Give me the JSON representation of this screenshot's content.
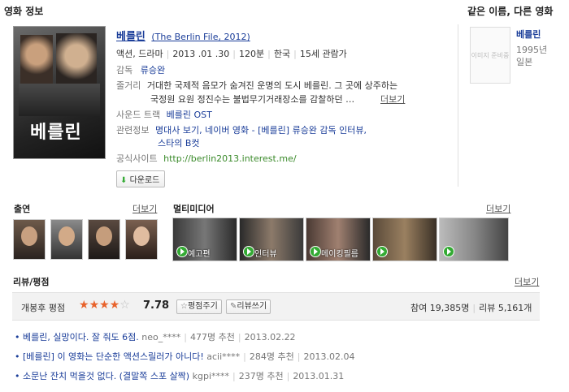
{
  "section_title": "영화 정보",
  "related_title": "같은 이름, 다른 영화",
  "movie": {
    "title": "베를린",
    "title_en": "(The Berlin File, 2012)",
    "genre": "액션, 드라마",
    "release": "2013 .01 .30",
    "runtime": "120분",
    "country": "한국",
    "rating": "15세 관람가",
    "director_label": "감독",
    "director": "류승완",
    "plot_label": "줄거리",
    "plot_line1": "거대한 국제적 음모가 숨겨진 운명의 도시 베를린. 그 곳에 상주하는",
    "plot_line2": "국정원 요원 정진수는 불법무기거래장소를 감찰하던 …",
    "plot_more": "더보기",
    "ost_label": "사운드 트랙",
    "ost": "베를린 OST",
    "info_label": "관련정보",
    "info_line1": "명대사 보기, 네이버 영화 - [베를린] 류승완 감독 인터뷰,",
    "info_line2": "스타의 B컷",
    "site_label": "공식사이트",
    "site": "http://berlin2013.interest.me/",
    "download": "다운로드"
  },
  "related": {
    "placeholder": "이미지 준비중",
    "title": "베를린",
    "year": "1995년",
    "country": "일본"
  },
  "cast": {
    "title": "출연",
    "more": "더보기"
  },
  "multimedia": {
    "title": "멀티미디어",
    "more": "더보기",
    "items": [
      "예고편",
      "인터뷰",
      "메이킹필름"
    ]
  },
  "reviews": {
    "title": "리뷰/평점",
    "more": "더보기",
    "rating_label": "개봉후 평점",
    "score": "7.78",
    "stars_filled": 4,
    "rate_button": "평점주기",
    "review_button": "리뷰쓰기",
    "participants": "참여 19,385명",
    "review_count": "리뷰 5,161개",
    "items": [
      {
        "title": "베를린, 실망이다. 잘 줘도 6점.",
        "user": "neo_****",
        "votes": "477명 추천",
        "date": "2013.02.22"
      },
      {
        "title": "[베를린] 이 영화는 단순한 액션스릴러가 아니다!",
        "user": "acii****",
        "votes": "284명 추천",
        "date": "2013.02.04"
      },
      {
        "title": "소문난 잔치 먹을것 없다. (결말쪽 스포 살짝)",
        "user": "kgpi****",
        "votes": "237명 추천",
        "date": "2013.01.31"
      }
    ]
  },
  "colors": {
    "link": "#1a3d99",
    "green": "#3a3",
    "star": "#e8622b"
  }
}
